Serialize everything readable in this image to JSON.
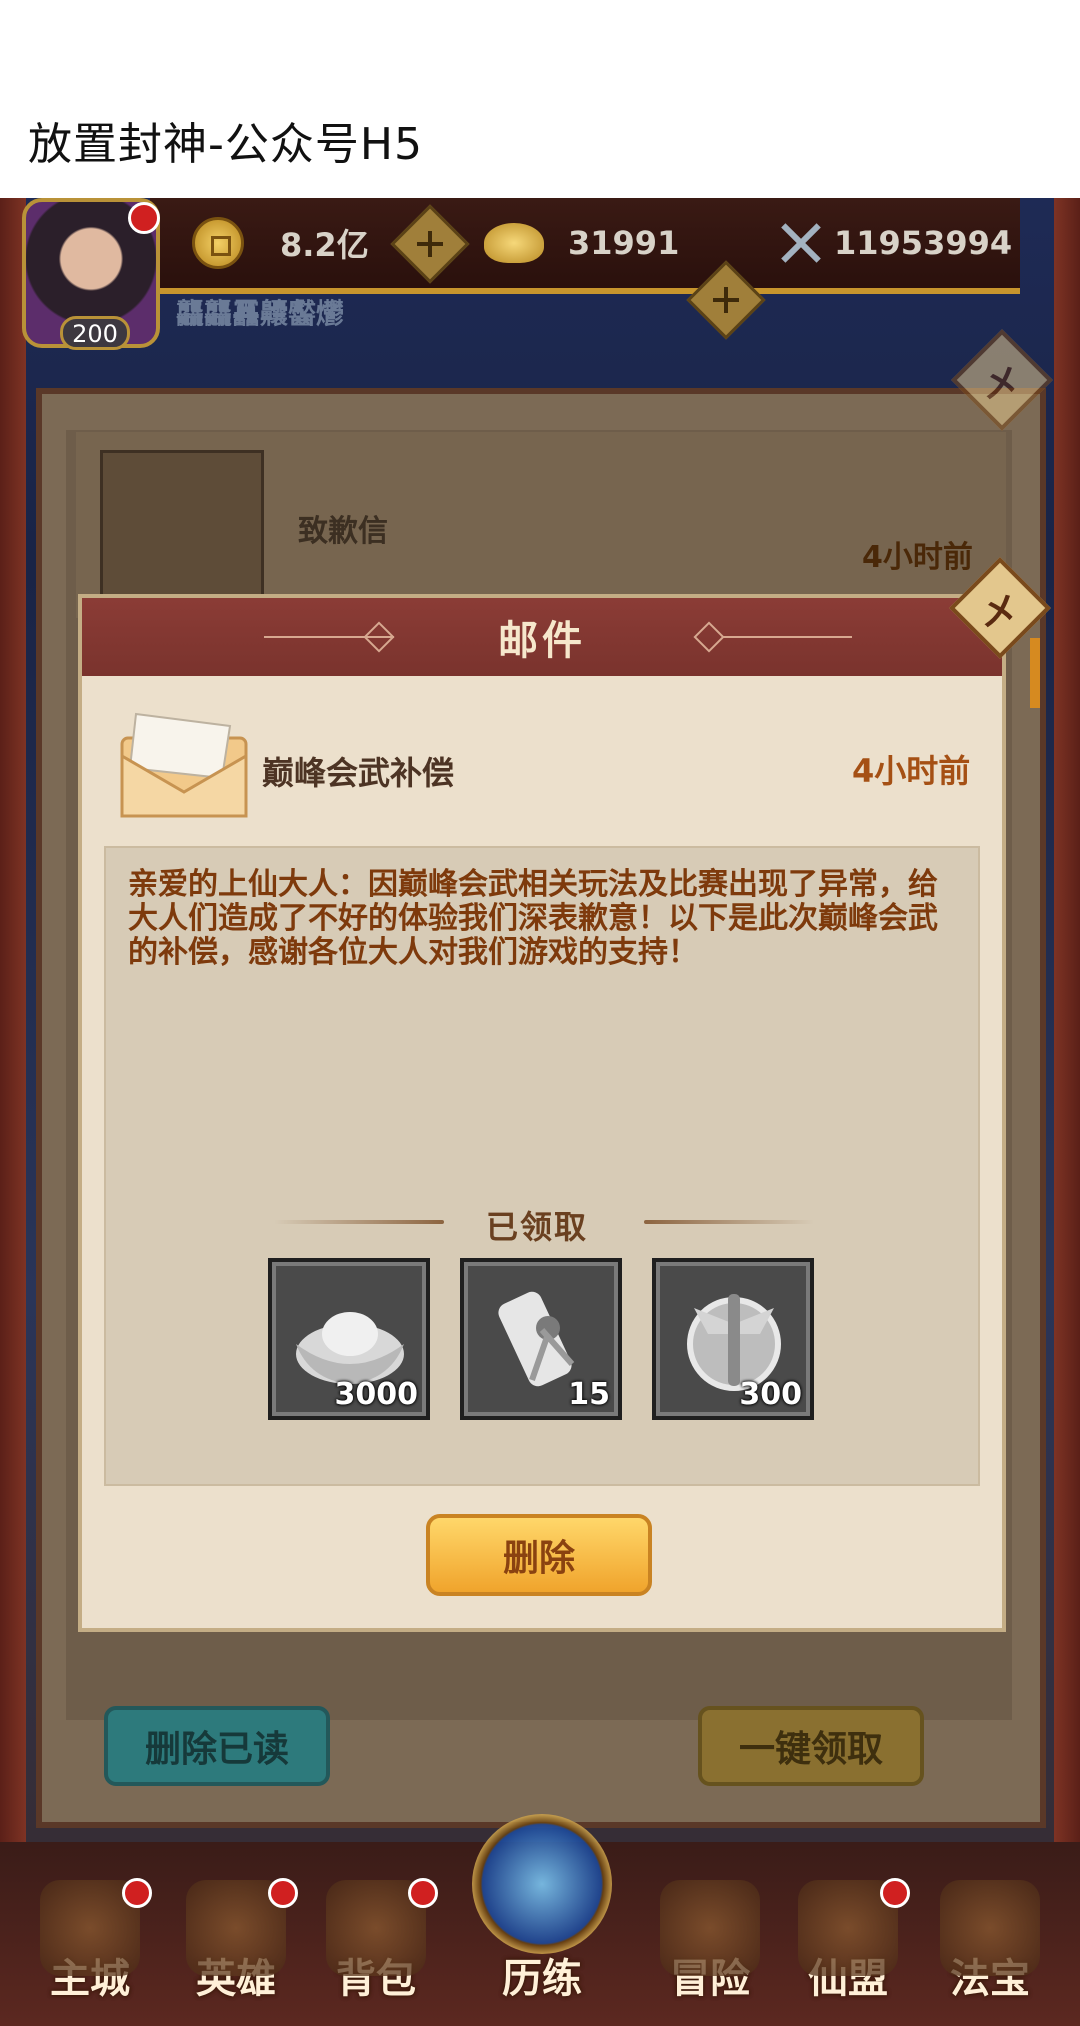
{
  "browser": {
    "title": "放置封神-公众号H5"
  },
  "player": {
    "level": "200",
    "name": "龘龘靐齉齾爩"
  },
  "resources": [
    {
      "icon": "copper-coin-icon",
      "value": "8.2亿"
    },
    {
      "icon": "gold-ingot-icon",
      "value": "31991"
    },
    {
      "icon": "battle-power-icon",
      "value": "11953994"
    }
  ],
  "mail_list": {
    "item": {
      "title": "致歉信",
      "time": "4小时前"
    },
    "delete_read_label": "删除已读",
    "claim_all_label": "一键领取"
  },
  "modal": {
    "title": "邮件",
    "subject": "巅峰会武补偿",
    "time": "4小时前",
    "body": "亲爱的上仙大人：因巅峰会武相关玩法及比赛出现了异常，给大人们造成了不好的体验我们深表歉意！以下是此次巅峰会武的补偿，感谢各位大人对我们游戏的支持！",
    "claimed_label": "已领取",
    "rewards": [
      {
        "icon": "ingot-icon",
        "count": "3000"
      },
      {
        "icon": "scroll-icon",
        "count": "15"
      },
      {
        "icon": "emblem-icon",
        "count": "300"
      }
    ],
    "delete_label": "删除"
  },
  "nav": {
    "items": [
      {
        "label": "主城",
        "badge": true
      },
      {
        "label": "英雄",
        "badge": true
      },
      {
        "label": "背包",
        "badge": true
      },
      {
        "label": "历练",
        "badge": false
      },
      {
        "label": "冒险",
        "badge": false
      },
      {
        "label": "仙盟",
        "badge": true
      },
      {
        "label": "法宝",
        "badge": false
      }
    ]
  },
  "colors": {
    "modal_header": "#8b3c36",
    "body_text": "#7e3a0c",
    "time_text": "#a55014",
    "delete_button": "#f0a42c",
    "badge": "#d02020"
  }
}
